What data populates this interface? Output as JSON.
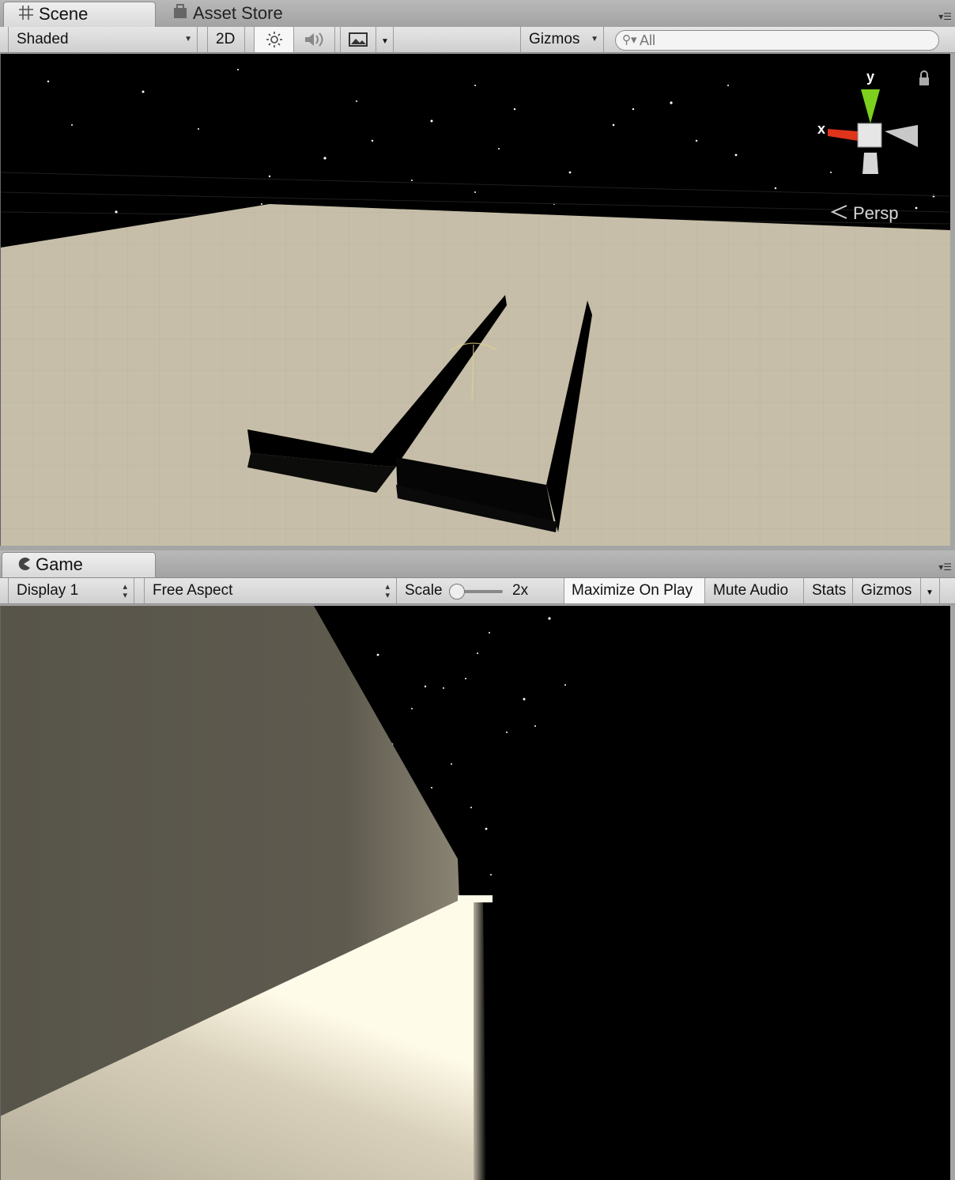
{
  "scene_panel": {
    "tabs": [
      {
        "label": "Scene",
        "icon": "grid-icon",
        "active": true
      },
      {
        "label": "Asset Store",
        "icon": "asset-store-bag-icon",
        "active": false
      }
    ],
    "toolbar": {
      "shading_mode": "Shaded",
      "toggle_2d": "2D",
      "lighting_icon": "sun-icon",
      "audio_icon": "speaker-icon",
      "effects_icon": "image-icon",
      "gizmos_label": "Gizmos",
      "search_placeholder": "All"
    },
    "view": {
      "projection_label": "Persp",
      "axis_x": "x",
      "axis_y": "y",
      "lock_icon": "lock-icon"
    }
  },
  "game_panel": {
    "tabs": [
      {
        "label": "Game",
        "icon": "pacman-icon",
        "active": true
      }
    ],
    "toolbar": {
      "display": "Display 1",
      "aspect": "Free Aspect",
      "scale_label": "Scale",
      "scale_value": "2x",
      "scale_level": 0.0,
      "maximize_on_play": "Maximize On Play",
      "mute_audio": "Mute Audio",
      "stats": "Stats",
      "gizmos": "Gizmos"
    }
  },
  "colors": {
    "floor": "#c6bea8",
    "sky": "#000000",
    "axis_x": "#e0341b",
    "axis_y": "#7dd01d",
    "panel_bg": "#a5a5a5",
    "toolbar_bg": "#dadada"
  }
}
